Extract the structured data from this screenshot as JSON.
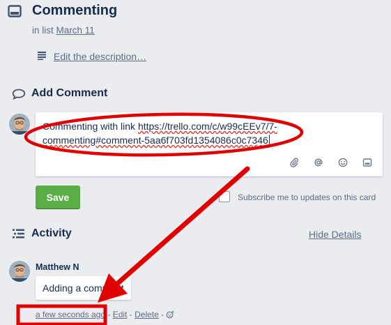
{
  "card": {
    "title": "Commenting",
    "in_list_prefix": "in list",
    "list_name": "March 11",
    "edit_description": "Edit the description…"
  },
  "add_comment": {
    "title": "Add Comment",
    "text_prefix": "Commenting with link ",
    "link_line1": "https://trello.com/c/w99cEEv7/7-",
    "link_line2": "commenting#comment-5aa6f703fd1354086c0c7346",
    "toolbar_icons": [
      "paperclip-icon",
      "at-sign-icon",
      "emoji-icon",
      "card-icon"
    ],
    "save_label": "Save",
    "subscribe_label": "Subscribe me to updates on this card"
  },
  "activity": {
    "title": "Activity",
    "hide_details": "Hide Details",
    "items": [
      {
        "author": "Matthew N",
        "text": "Adding a comment",
        "time": "a few seconds ago",
        "edit": "Edit",
        "delete": "Delete"
      }
    ]
  },
  "colors": {
    "background": "#ebecf0",
    "save_button": "#5aac44",
    "annotation": "#e00000"
  }
}
